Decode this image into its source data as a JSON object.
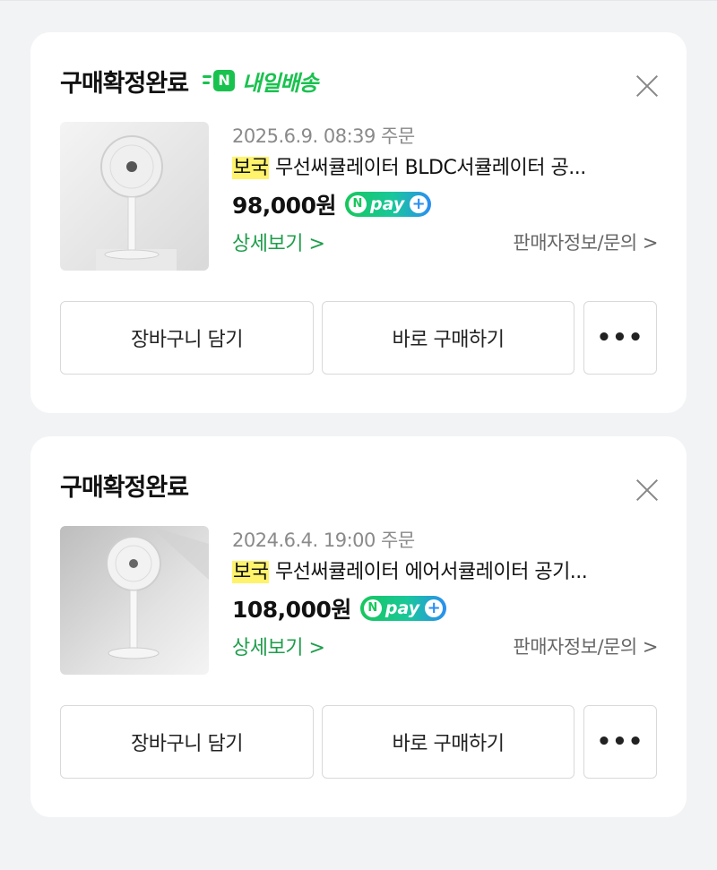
{
  "orders": [
    {
      "status": "구매확정완료",
      "delivery_badge": "내일배송",
      "delivery_icon_letter": "N",
      "order_date": "2025.6.9. 08:39 주문",
      "brand": "보국",
      "product_name": "무선써큘레이터 BLDC서큘레이터 공...",
      "price": "98,000원",
      "npay": {
        "n": "N",
        "pay": "pay",
        "plus": "+"
      },
      "detail_link": "상세보기 >",
      "seller_link": "판매자정보/문의 >",
      "buttons": {
        "cart": "장바구니 담기",
        "buy": "바로 구매하기",
        "more": "•••"
      },
      "close_icon": "close-icon"
    },
    {
      "status": "구매확정완료",
      "order_date": "2024.6.4. 19:00 주문",
      "brand": "보국",
      "product_name": "무선써큘레이터 에어서큘레이터 공기...",
      "price": "108,000원",
      "npay": {
        "n": "N",
        "pay": "pay",
        "plus": "+"
      },
      "detail_link": "상세보기 >",
      "seller_link": "판매자정보/문의 >",
      "buttons": {
        "cart": "장바구니 담기",
        "buy": "바로 구매하기",
        "more": "•••"
      },
      "close_icon": "close-icon"
    }
  ],
  "colors": {
    "accent_green": "#19c24e",
    "link_green": "#1e9d4b",
    "brand_highlight": "#fff36b"
  }
}
